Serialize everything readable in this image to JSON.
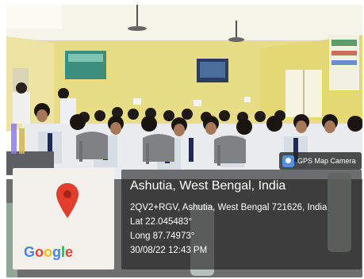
{
  "photo": {
    "scene": "classroom",
    "map_inset": {
      "pin_icon": "map-pin-icon",
      "logo_text": "Google",
      "colors": {
        "blue": "#4285f4",
        "red": "#ea4335",
        "yellow": "#fbbc05",
        "green": "#34a853"
      }
    },
    "gps_badge": {
      "label": "GPS Map Camera",
      "icon": "gps-camera-app-icon"
    },
    "location": {
      "title": "Ashutia, West Bengal, India",
      "address": "2QV2+RGV, Ashutia, West Bengal 721626, India",
      "latitude": "Lat 22.045483°",
      "longitude": "Long 87.74973°",
      "timestamp": "30/08/22 12:43 PM"
    }
  }
}
